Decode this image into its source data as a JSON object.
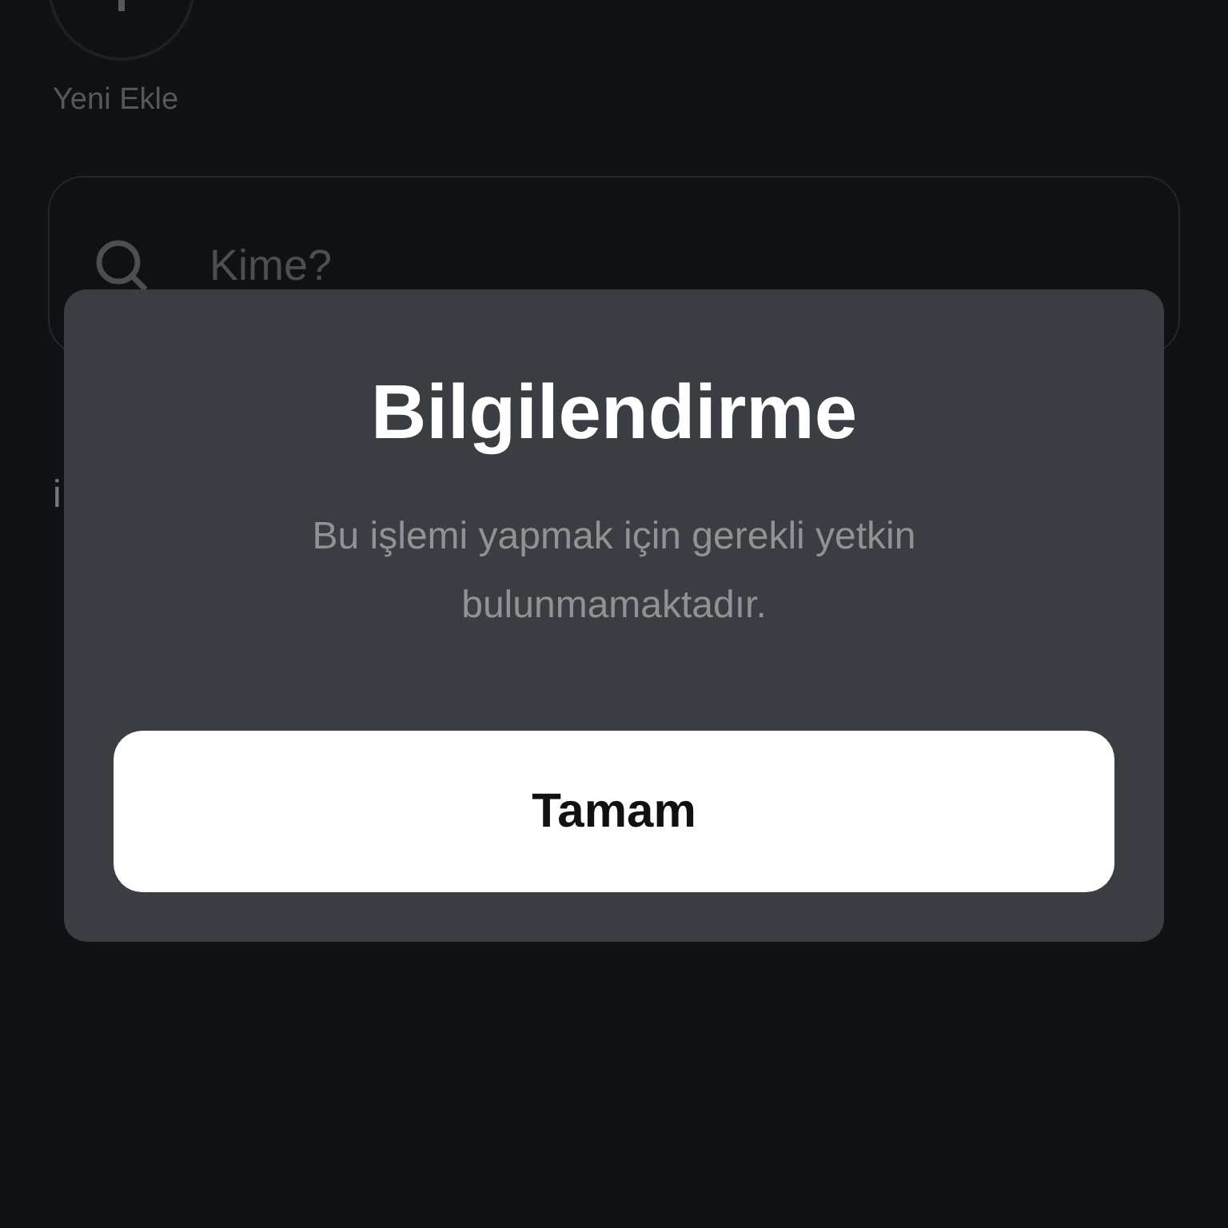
{
  "background": {
    "add_label": "Yeni Ekle",
    "search": {
      "placeholder": "Kime?"
    },
    "text_fragments": [
      "i"
    ]
  },
  "dialog": {
    "title": "Bilgilendirme",
    "message": "Bu işlemi yapmak için gerekli yetkin bulunmamaktadır.",
    "buttons": [
      "Tamam"
    ]
  }
}
